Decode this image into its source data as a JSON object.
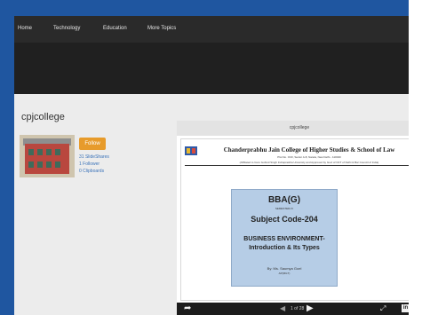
{
  "colors": {
    "background": "#1f56a0",
    "navbar": "#2a2a2a",
    "follow_button": "#e79b2b",
    "link": "#3b73b9",
    "slide_box": "#b6cde6"
  },
  "nav": {
    "items": [
      "Home",
      "Technology",
      "Education",
      "More Topics"
    ]
  },
  "profile": {
    "name": "cpjcollege",
    "follow_label": "Follow",
    "slideshares": "31 SlideShares",
    "followers": "1 Follower",
    "clipboards": "0 Clipboards"
  },
  "viewer": {
    "title": "cpjcollege",
    "slide": {
      "college_name": "Chanderprabhu Jain College of Higher Studies & School of Law",
      "address": "Plot No. OCF, Sector A-8, Narela, New Delhi - 110040",
      "affiliation": "(Affiliated to Guru Gobind Singh Indraprastha University and Approved by Govt of NCT of Delhi & Bar Council of India)",
      "course": "BBA(G)",
      "semester": "SEMESTER-IV",
      "subject": "Subject Code-204",
      "topic_line1": "BUSINESS ENVIRONMENT-",
      "topic_line2": "Introduction & Its Types",
      "author": "By: Ms. Saumya Goel",
      "author_role": "AP(MGT)"
    },
    "controls": {
      "page_indicator": "1 of 28",
      "share_icon": "share-icon",
      "prev_icon": "prev-icon",
      "next_icon": "next-icon",
      "expand_icon": "expand-icon",
      "linkedin_icon": "linkedin-icon"
    }
  }
}
